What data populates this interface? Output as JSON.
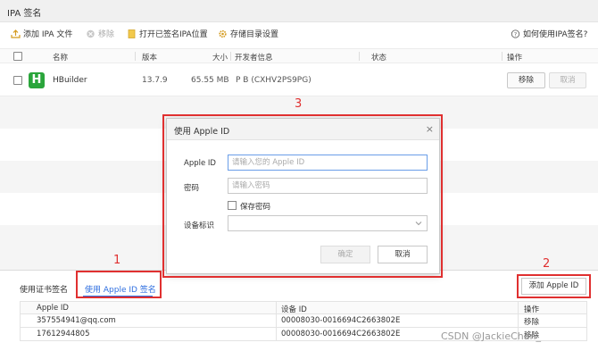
{
  "window": {
    "title": "IPA 签名"
  },
  "toolbar": {
    "add_ipa": "添加 IPA 文件",
    "remove": "移除",
    "open_signed": "打开已签名IPA位置",
    "storage_settings": "存储目录设置",
    "help": "如何使用IPA签名?"
  },
  "table": {
    "headers": [
      "名称",
      "版本",
      "大小",
      "开发者信息",
      "状态",
      "操作"
    ],
    "rows": [
      {
        "logo": "H",
        "name": "HBuilder",
        "version": "13.7.9",
        "size": "65.55 MB",
        "developer": "P B (CXHV2PS9PG)",
        "remove": "移除",
        "cancel": "取消"
      }
    ]
  },
  "dialog": {
    "title": "使用 Apple ID",
    "apple_id_label": "Apple ID",
    "apple_id_placeholder": "请输入您的 Apple ID",
    "password_label": "密码",
    "password_placeholder": "请输入密码",
    "save_password": "保存密码",
    "device_label": "设备标识",
    "confirm": "确定",
    "cancel": "取消"
  },
  "bottom": {
    "tab_cert": "使用证书签名",
    "tab_appleid": "使用 Apple ID 签名",
    "add_appleid": "添加 Apple ID",
    "headers": [
      "Apple ID",
      "设备 ID",
      "操作"
    ],
    "rows": [
      {
        "apple_id": "357554941@qq.com",
        "device_id": "00008030-0016694C2663802E",
        "action": "移除"
      },
      {
        "apple_id": "17612944805",
        "device_id": "00008030-0016694C2663802E",
        "action": "移除"
      }
    ]
  },
  "annotations": [
    "1",
    "2",
    "3"
  ],
  "watermark": "CSDN @JackieChan_",
  "colors": {
    "accent": "#2f6fe0",
    "annotation": "#e03030",
    "logo": "#2aa53b"
  }
}
